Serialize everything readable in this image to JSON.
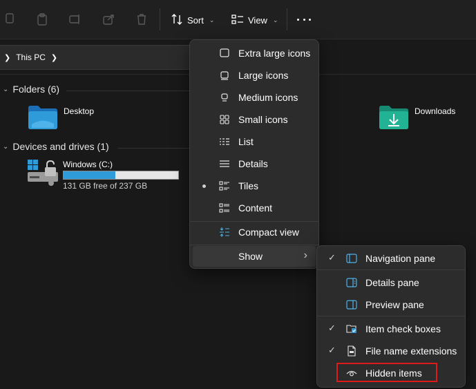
{
  "toolbar": {
    "sort_label": "Sort",
    "view_label": "View",
    "icons": [
      "copy-icon",
      "paste-icon",
      "rename-icon",
      "share-icon",
      "delete-icon",
      "sort-icon",
      "view-icon",
      "more-icon"
    ]
  },
  "address": {
    "location": "This PC"
  },
  "folders": {
    "header": "Folders (6)",
    "items": [
      {
        "name": "Desktop",
        "icon": "desktop-folder-icon"
      },
      {
        "name": "Downloads",
        "icon": "downloads-folder-icon"
      }
    ]
  },
  "devices": {
    "header": "Devices and drives (1)",
    "drive": {
      "name": "Windows (C:)",
      "free_text": "131 GB free of 237 GB",
      "used_fraction": 0.45,
      "icon": "drive-c-icon"
    }
  },
  "view_menu": {
    "items": [
      {
        "label": "Extra large icons",
        "icon": "extra-large-icons-icon"
      },
      {
        "label": "Large icons",
        "icon": "large-icons-icon"
      },
      {
        "label": "Medium icons",
        "icon": "medium-icons-icon"
      },
      {
        "label": "Small icons",
        "icon": "small-icons-icon"
      },
      {
        "label": "List",
        "icon": "list-icon"
      },
      {
        "label": "Details",
        "icon": "details-icon"
      },
      {
        "label": "Tiles",
        "icon": "tiles-icon",
        "selected": true
      },
      {
        "label": "Content",
        "icon": "content-icon"
      },
      {
        "label": "Compact view",
        "icon": "compact-view-icon"
      },
      {
        "label": "Show",
        "has_submenu": true
      }
    ]
  },
  "show_menu": {
    "items": [
      {
        "label": "Navigation pane",
        "checked": true,
        "icon": "navigation-pane-icon"
      },
      {
        "label": "Details pane",
        "checked": false,
        "icon": "details-pane-icon"
      },
      {
        "label": "Preview pane",
        "checked": false,
        "icon": "preview-pane-icon"
      },
      {
        "label": "Item check boxes",
        "checked": true,
        "icon": "item-check-boxes-icon"
      },
      {
        "label": "File name extensions",
        "checked": true,
        "icon": "file-name-extensions-icon"
      },
      {
        "label": "Hidden items",
        "checked": false,
        "icon": "hidden-items-icon",
        "annotated": true
      }
    ]
  },
  "colors": {
    "accent": "#2f9bd9",
    "highlight_box": "#e01a1a",
    "menu_bg": "#2c2c2c",
    "app_bg": "#191919"
  }
}
